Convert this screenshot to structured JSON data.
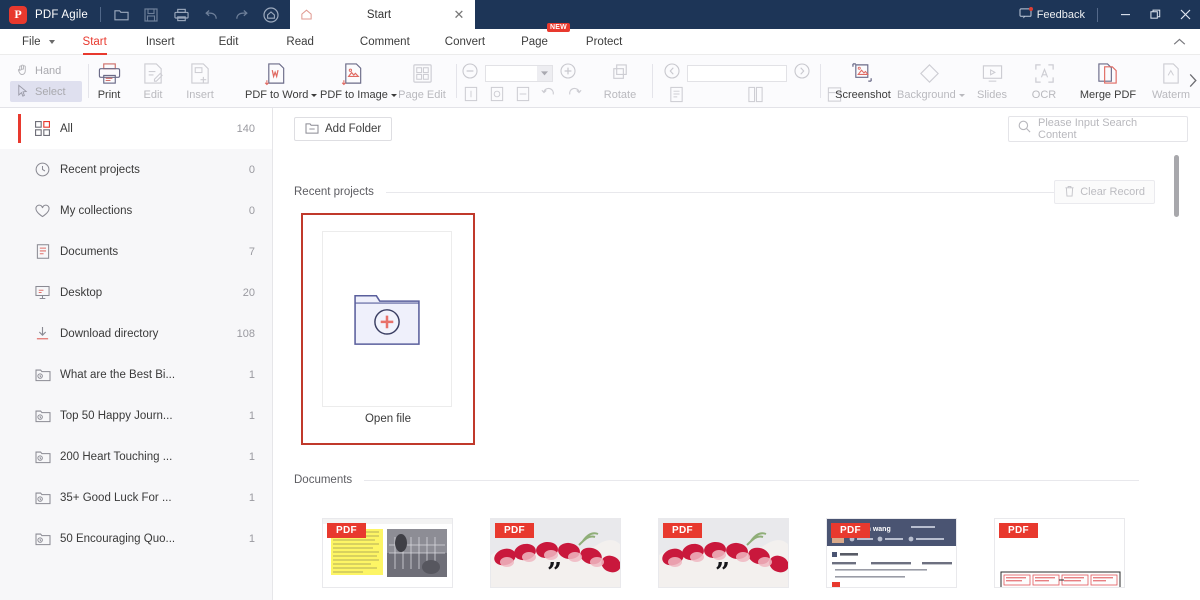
{
  "titlebar": {
    "brand_letter": "P",
    "brand_name": "PDF Agile",
    "icons": [
      "open-folder-icon",
      "save-icon",
      "print-icon",
      "undo-icon",
      "redo-icon",
      "home-circle-icon"
    ],
    "tab": {
      "label": "Start",
      "home_icon": "home-icon",
      "close_icon": "close-icon"
    },
    "feedback_label": "Feedback",
    "minimize_label": "—",
    "maximize_label": "❐",
    "close_label": "✕",
    "accent_color": "#e8392e",
    "bar_color": "#1d3557"
  },
  "menubar": {
    "file_label": "File",
    "items": [
      {
        "label": "Start",
        "active": true,
        "badge": ""
      },
      {
        "label": "Insert",
        "active": false,
        "badge": ""
      },
      {
        "label": "Edit",
        "active": false,
        "badge": ""
      },
      {
        "label": "Read",
        "active": false,
        "badge": ""
      },
      {
        "label": "Comment",
        "active": false,
        "badge": ""
      },
      {
        "label": "Convert",
        "active": false,
        "badge": ""
      },
      {
        "label": "Page",
        "active": false,
        "badge": "NEW"
      },
      {
        "label": "Protect",
        "active": false,
        "badge": ""
      }
    ],
    "collapse_icon": "chevron-up-icon"
  },
  "ribbon": {
    "hand_label": "Hand",
    "select_label": "Select",
    "print_label": "Print",
    "edit_label": "Edit",
    "insert_label": "Insert",
    "pdf_to_word_label": "PDF to Word",
    "pdf_to_image_label": "PDF to Image",
    "page_edit_label": "Page Edit",
    "rotate_label": "Rotate",
    "zoom_value": "",
    "page_value": "",
    "screenshot_label": "Screenshot",
    "background_label": "Background",
    "slides_label": "Slides",
    "ocr_label": "OCR",
    "merge_pdf_label": "Merge PDF",
    "watermark_label": "Waterm",
    "more_icon": "chevron-right-icon"
  },
  "sidebar": {
    "items": [
      {
        "label": "All",
        "count": "140",
        "icon": "grid-icon",
        "active": true
      },
      {
        "label": "Recent projects",
        "count": "0",
        "icon": "clock-icon",
        "active": false
      },
      {
        "label": "My collections",
        "count": "0",
        "icon": "heart-icon",
        "active": false
      },
      {
        "label": "Documents",
        "count": "7",
        "icon": "document-icon",
        "active": false
      },
      {
        "label": "Desktop",
        "count": "20",
        "icon": "monitor-icon",
        "active": false
      },
      {
        "label": "Download directory",
        "count": "108",
        "icon": "download-icon",
        "active": false
      },
      {
        "label": "What are the Best Bi...",
        "count": "1",
        "icon": "folder-clock-icon",
        "active": false
      },
      {
        "label": "Top 50 Happy Journ...",
        "count": "1",
        "icon": "folder-clock-icon",
        "active": false
      },
      {
        "label": "200 Heart Touching ...",
        "count": "1",
        "icon": "folder-clock-icon",
        "active": false
      },
      {
        "label": "35+ Good Luck For ...",
        "count": "1",
        "icon": "folder-clock-icon",
        "active": false
      },
      {
        "label": "50 Encouraging Quo...",
        "count": "1",
        "icon": "folder-clock-icon",
        "active": false
      }
    ]
  },
  "content": {
    "add_folder_label": "Add Folder",
    "search_placeholder": "Please Input Search Content",
    "recent_projects_title": "Recent projects",
    "clear_record_label": "Clear Record",
    "open_file_label": "Open file",
    "documents_title": "Documents",
    "documents": [
      {
        "badge": "PDF",
        "kind": "article-highlight-thumb"
      },
      {
        "badge": "PDF",
        "kind": "flower-quote-thumb"
      },
      {
        "badge": "PDF",
        "kind": "flower-quote-thumb"
      },
      {
        "badge": "PDF",
        "kind": "resume-thumb"
      },
      {
        "badge": "PDF",
        "kind": "blank-form-thumb"
      }
    ]
  }
}
